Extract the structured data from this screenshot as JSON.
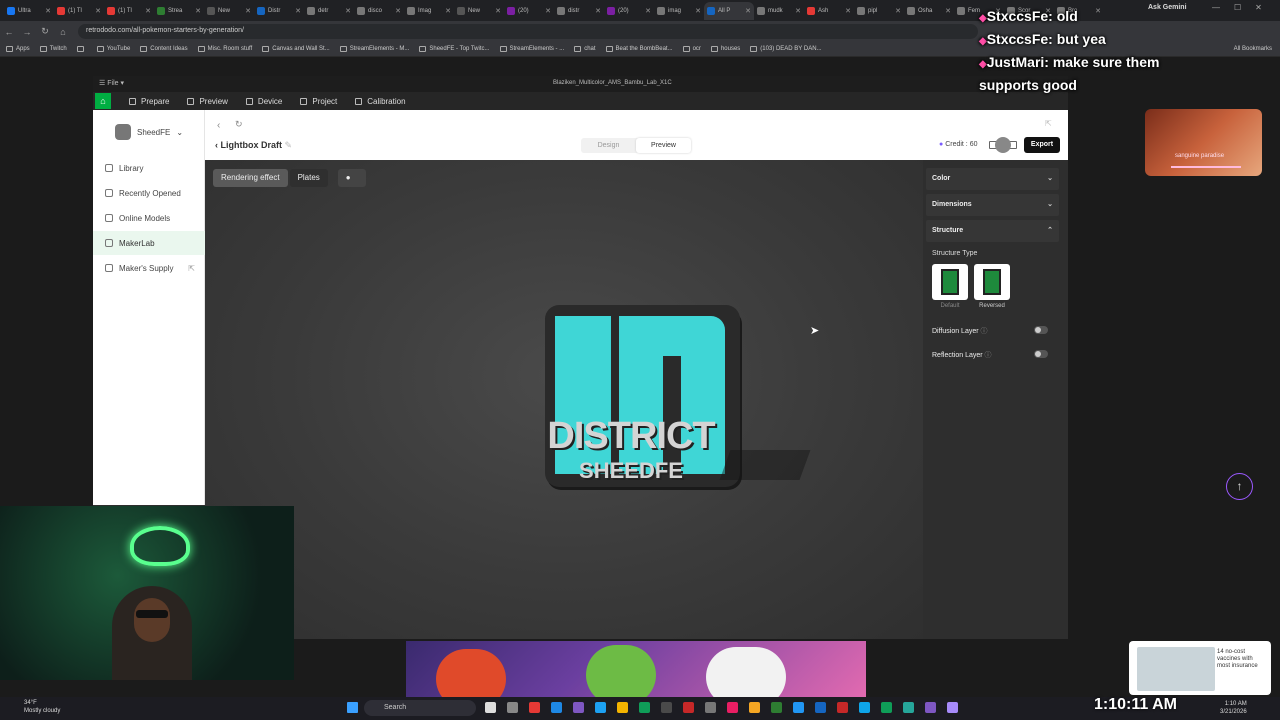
{
  "browser": {
    "tabs": [
      "Ultra",
      "(1) Tl",
      "(1) Tl",
      "Strea",
      "New",
      "Distr",
      "detr",
      "disco",
      "Imag",
      "New",
      "(20)",
      "distr",
      "(20)",
      "imag",
      "All P",
      "mudk",
      "Ash",
      "pipl",
      "Osha",
      "Fem",
      "Scor",
      "Bro"
    ],
    "active_tab": 14,
    "gemini_label": "Ask Gemini",
    "url": "retrododo.com/all-pokemon-starters-by-generation/",
    "bookmarks": [
      "Apps",
      "Twitch",
      "",
      "YouTube",
      "Content Ideas",
      "Misc. Room stuff",
      "Canvas and Wall St...",
      "StreamElements - M...",
      "SheedFE - Top Twitc...",
      "StreamElements - ...",
      "chat",
      "Beat the BombBeat...",
      "ocr",
      "houses",
      "(103) DEAD BY DAN..."
    ],
    "all_bookmarks": "All Bookmarks"
  },
  "app": {
    "window_title": "Blaziken_Multicolor_AMS_Bambu_Lab_X1C",
    "file_menu": "File",
    "nav": [
      "Prepare",
      "Preview",
      "Device",
      "Project",
      "Calibration"
    ],
    "user": "SheedFE",
    "sidebar": [
      "Library",
      "Recently Opened",
      "Online Models",
      "MakerLab",
      "Maker's Supply"
    ],
    "sidebar_active": 3,
    "title": "Lightbox Draft",
    "segments": [
      "Design",
      "Preview"
    ],
    "segment_active": 1,
    "credit": "Credit : 60",
    "export": "Export",
    "render_tabs": [
      "Rendering effect",
      "Plates"
    ],
    "logo_line1": "DISTRICT",
    "logo_line2": "SHEEDFE",
    "panel": {
      "sections": [
        "Color",
        "Dimensions",
        "Structure"
      ],
      "structure_type_label": "Structure Type",
      "types": [
        "Default",
        "Reversed"
      ],
      "diffusion_label": "Diffusion Layer",
      "reflection_label": "Reflection Layer"
    }
  },
  "chat": [
    {
      "name": "StxccsFe:",
      "msg": " old"
    },
    {
      "name": "StxccsFe:",
      "msg": " but yea"
    },
    {
      "name": "JustMari:",
      "msg": " make sure them"
    },
    {
      "name": "",
      "msg": "supports good"
    }
  ],
  "music": {
    "title": "sanguine paradise"
  },
  "ad": {
    "line1": "14 no-cost",
    "line2": "vaccines with",
    "line3": "most insurance"
  },
  "taskbar": {
    "weather_temp": "34°F",
    "weather_desc": "Mostly cloudy",
    "search": "Search",
    "clock": "1:10:11 AM",
    "time_small": "1:10 AM",
    "date_small": "3/21/2026"
  },
  "colors": {
    "accent": "#00ae42",
    "logo_cyan": "#3fd6d6",
    "brand_dark": "#111111"
  }
}
